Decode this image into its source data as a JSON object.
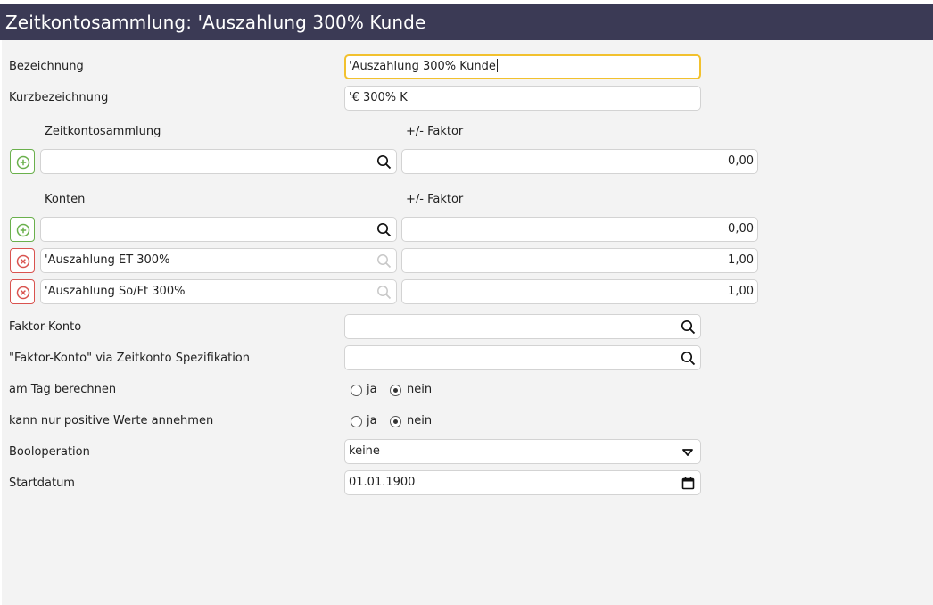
{
  "window": {
    "title": "Zeitkontosammlung: 'Auszahlung 300% Kunde"
  },
  "fields": {
    "bezeichnung": {
      "label": "Bezeichnung",
      "value": "'Auszahlung 300% Kunde"
    },
    "kurzbezeichnung": {
      "label": "Kurzbezeichnung",
      "value": "'€ 300% K"
    }
  },
  "zeitkontosammlung": {
    "column_label": "Zeitkontosammlung",
    "factor_label": "+/- Faktor",
    "rows": [
      {
        "value": "",
        "factor": "0,00"
      }
    ]
  },
  "konten": {
    "column_label": "Konten",
    "factor_label": "+/- Faktor",
    "new_row": {
      "value": "",
      "factor": "0,00"
    },
    "rows": [
      {
        "value": "'Auszahlung ET 300%",
        "factor": "1,00"
      },
      {
        "value": "'Auszahlung So/Ft 300%",
        "factor": "1,00"
      }
    ]
  },
  "faktor_konto": {
    "label": "Faktor-Konto",
    "value": ""
  },
  "faktor_konto_spez": {
    "label": "\"Faktor-Konto\" via Zeitkonto Spezifikation",
    "value": ""
  },
  "am_tag": {
    "label": "am Tag berechnen",
    "options": [
      "ja",
      "nein"
    ],
    "selected": "nein"
  },
  "nur_positiv": {
    "label": "kann nur positive Werte annehmen",
    "options": [
      "ja",
      "nein"
    ],
    "selected": "nein"
  },
  "booloperation": {
    "label": "Booloperation",
    "value": "keine"
  },
  "startdatum": {
    "label": "Startdatum",
    "value": "01.01.1900"
  },
  "colors": {
    "titlebar": "#3b3a55",
    "focus": "#f2c12e",
    "add": "#6ab04c",
    "delete": "#d9534f",
    "background": "#f3f3f3"
  }
}
